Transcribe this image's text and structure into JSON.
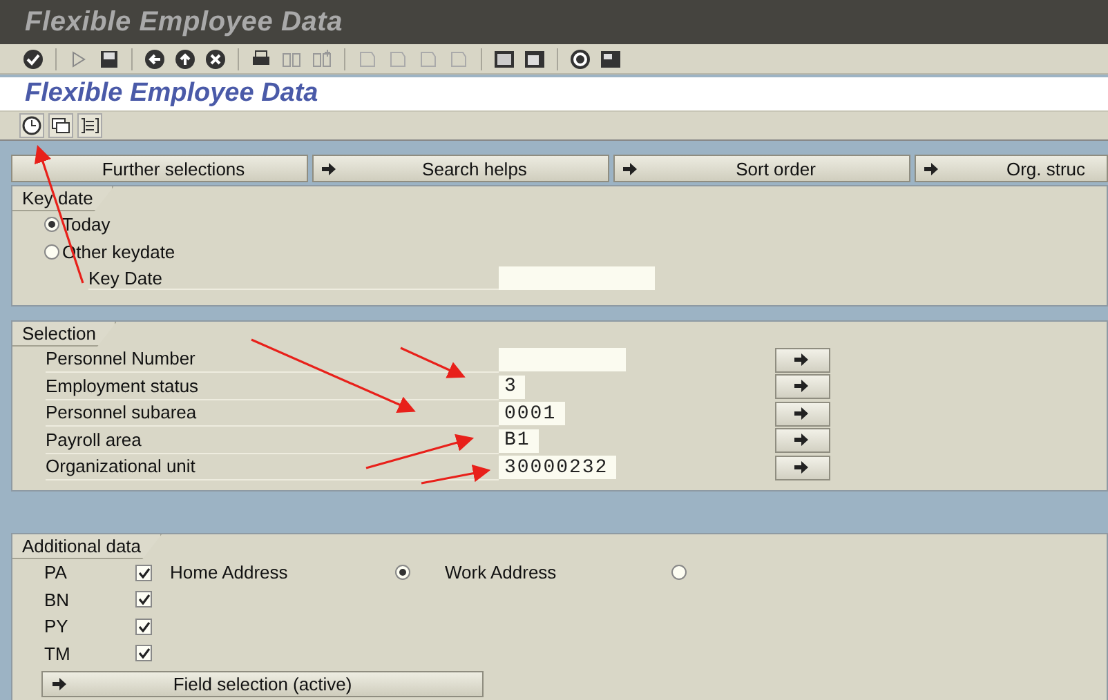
{
  "window": {
    "title": "Flexible Employee Data"
  },
  "screen_title": "Flexible Employee Data",
  "tab_buttons": [
    {
      "label": "Further selections",
      "kind": "plain"
    },
    {
      "label": "Search helps",
      "kind": "arrow"
    },
    {
      "label": "Sort order",
      "kind": "arrow"
    },
    {
      "label": "Org. struc",
      "kind": "arrow"
    }
  ],
  "key_date": {
    "title": "Key date",
    "options": [
      {
        "label": "Today",
        "selected": true
      },
      {
        "label": "Other keydate",
        "selected": false
      }
    ],
    "field": {
      "label": "Key Date"
    }
  },
  "selection": {
    "title": "Selection",
    "rows": [
      {
        "label": "Personnel Number"
      },
      {
        "label": "Employment status",
        "value": "3"
      },
      {
        "label": "Personnel subarea",
        "value": "0001"
      },
      {
        "label": "Payroll area",
        "value": "B1"
      },
      {
        "label": "Organizational unit",
        "value": "30000232"
      }
    ]
  },
  "additional_data": {
    "title": "Additional data",
    "items": [
      {
        "label": "PA",
        "checked": true
      },
      {
        "label": "BN",
        "checked": true
      },
      {
        "label": "PY",
        "checked": true
      },
      {
        "label": "TM",
        "checked": true
      }
    ],
    "address_options": [
      {
        "label": "Home Address",
        "selected": true
      },
      {
        "label": "Work Address",
        "selected": false
      }
    ],
    "button": "Field selection (active)"
  }
}
